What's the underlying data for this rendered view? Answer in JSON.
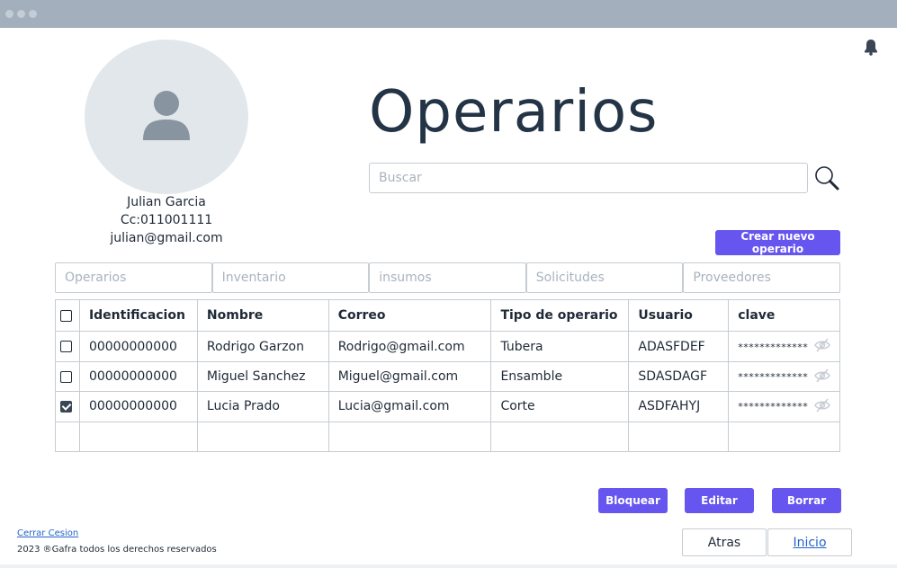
{
  "window": {
    "dots": [
      "dot",
      "dot",
      "dot"
    ]
  },
  "profile": {
    "name": "Julian Garcia",
    "id_line": "Cc:011001111",
    "email": "julian@gmail.com"
  },
  "page": {
    "title": "Operarios"
  },
  "search": {
    "placeholder": "Buscar",
    "value": ""
  },
  "actions": {
    "create_label": "Crear  nuevo operario"
  },
  "tabs": [
    "Operarios",
    "Inventario",
    "insumos",
    "Solicitudes",
    "Proveedores"
  ],
  "table": {
    "columns": [
      "Identificacion",
      "Nombre",
      "Correo",
      "Tipo de operario",
      "Usuario",
      "clave"
    ],
    "rows": [
      {
        "checked": false,
        "id": "00000000000",
        "name": "Rodrigo Garzon",
        "email": "Rodrigo@gmail.com",
        "type": "Tubera",
        "user": "ADASFDEF",
        "password": "*************"
      },
      {
        "checked": false,
        "id": "00000000000",
        "name": "Miguel Sanchez",
        "email": "Miguel@gmail.com",
        "type": "Ensamble",
        "user": "SDASDAGF",
        "password": "*************"
      },
      {
        "checked": true,
        "id": "00000000000",
        "name": "Lucia Prado",
        "email": "Lucia@gmail.com",
        "type": "Corte",
        "user": "ASDFAHYJ",
        "password": "*************"
      }
    ]
  },
  "row_actions": {
    "block": "Bloquear",
    "edit": "Editar",
    "delete": "Borrar"
  },
  "footer": {
    "logout": "Cerrar Cesion",
    "copyright": "2023 ®Gafra todos los derechos reservados",
    "back": "Atras",
    "home": "Inicio"
  },
  "colors": {
    "accent": "#6655ee",
    "titlebar": "#a3afbd",
    "border": "#c6ccd3",
    "link": "#2563c9"
  },
  "icons": {
    "bell": "bell-icon",
    "search": "magnifier-icon",
    "avatar": "user-icon",
    "eye": "eye-slash-icon"
  }
}
